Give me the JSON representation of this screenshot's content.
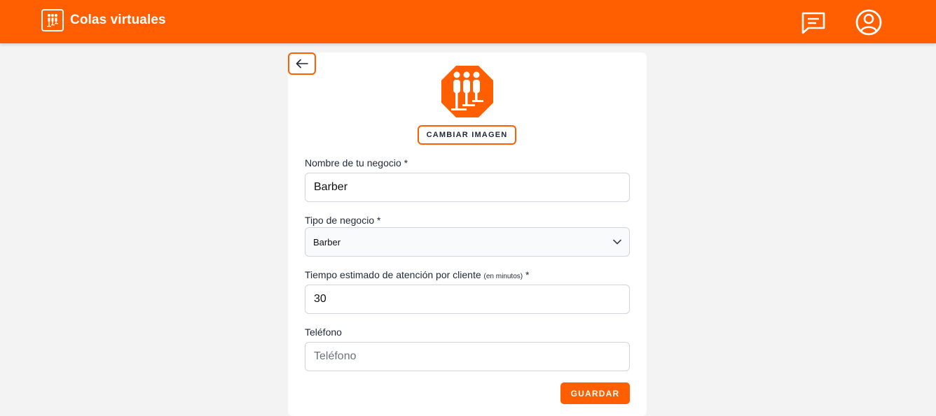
{
  "header": {
    "title": "Colas virtuales",
    "logo_icon": "queue-people-icon",
    "actions": [
      {
        "icon": "chat-icon"
      },
      {
        "icon": "user-account-icon"
      }
    ],
    "brand_color": "#ff5f00"
  },
  "form": {
    "back_icon": "arrow-left-icon",
    "logo_icon": "queue-people-icon",
    "change_image_label": "CAMBIAR IMAGEN",
    "business_name": {
      "label": "Nombre de tu negocio *",
      "value": "Barber"
    },
    "business_type": {
      "label": "Tipo de negocio *",
      "selected": "Barber"
    },
    "estimated_time": {
      "label": "Tiempo estimado de atención por cliente",
      "hint": "(en minutos)",
      "required_mark": "*",
      "value": "30"
    },
    "phone": {
      "label": "Teléfono",
      "value": "",
      "placeholder": "Teléfono"
    },
    "save_label": "GUARDAR"
  }
}
